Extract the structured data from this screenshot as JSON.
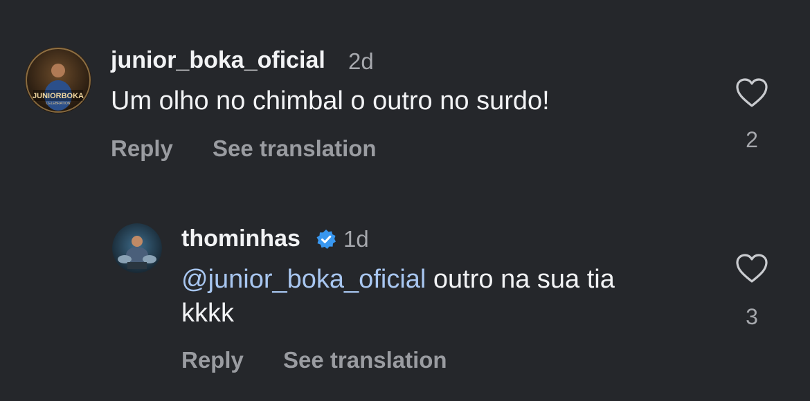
{
  "comments": [
    {
      "username": "junior_boka_oficial",
      "time": "2d",
      "text": "Um olho no chimbal o outro no surdo!",
      "reply_label": "Reply",
      "translate_label": "See translation",
      "like_count": "2",
      "avatar_text": "JUNIORBOKA",
      "avatar_subtext": "CELEBRATION"
    },
    {
      "username": "thominhas",
      "verified": true,
      "time": "1d",
      "mention": "@junior_boka_oficial",
      "text_line1": " outro na sua tia",
      "text_line2": "kkkk",
      "reply_label": "Reply",
      "translate_label": "See translation",
      "like_count": "3"
    }
  ],
  "colors": {
    "background": "#25272b",
    "primary_text": "#f2f3f5",
    "secondary_text": "#a6a8ad",
    "mention": "#a8c6f0",
    "verified_badge": "#3897f0"
  }
}
